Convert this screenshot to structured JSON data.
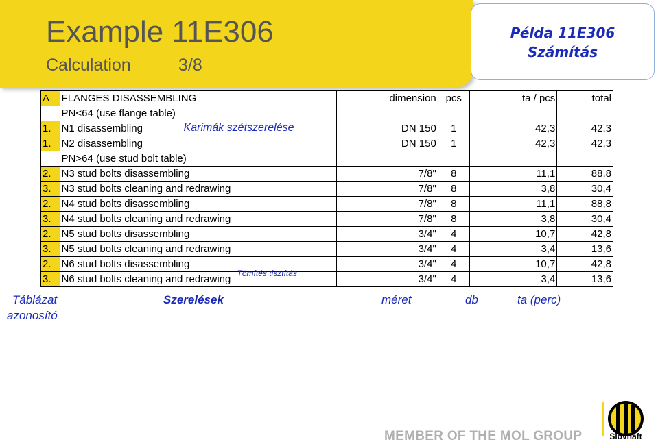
{
  "banner": {
    "title": "Example 11E306",
    "subtitle": "Calculation",
    "page": "3/8"
  },
  "callout": {
    "line1": "Példa  11E306",
    "line2": "Számítás"
  },
  "table": {
    "header": {
      "id": "A",
      "desc": "FLANGES DISASSEMBLING",
      "dim": "dimension",
      "pcs": "pcs",
      "ta": "ta / pcs",
      "total": "total"
    },
    "rows": [
      {
        "id": "",
        "desc": "PN<64 (use flange table)",
        "dim": "",
        "pcs": "",
        "ta": "",
        "total": ""
      },
      {
        "id": "1.",
        "desc": "N1 disassembling",
        "dim": "DN 150",
        "pcs": "1",
        "ta": "42,3",
        "total": "42,3"
      },
      {
        "id": "1.",
        "desc": "N2 disassembling",
        "dim": "DN 150",
        "pcs": "1",
        "ta": "42,3",
        "total": "42,3"
      },
      {
        "id": "",
        "desc": "PN>64 (use stud bolt table)",
        "dim": "",
        "pcs": "",
        "ta": "",
        "total": ""
      },
      {
        "id": "2.",
        "desc": "N3 stud bolts disassembling",
        "dim": "7/8\"",
        "pcs": "8",
        "ta": "11,1",
        "total": "88,8"
      },
      {
        "id": "3.",
        "desc": "N3 stud bolts cleaning and redrawing",
        "dim": "7/8\"",
        "pcs": "8",
        "ta": "3,8",
        "total": "30,4"
      },
      {
        "id": "2.",
        "desc": "N4 stud bolts disassembling",
        "dim": "7/8\"",
        "pcs": "8",
        "ta": "11,1",
        "total": "88,8"
      },
      {
        "id": "3.",
        "desc": "N4 stud bolts cleaning and redrawing",
        "dim": "7/8\"",
        "pcs": "8",
        "ta": "3,8",
        "total": "30,4"
      },
      {
        "id": "2.",
        "desc": "N5 stud bolts disassembling",
        "dim": "3/4\"",
        "pcs": "4",
        "ta": "10,7",
        "total": "42,8"
      },
      {
        "id": "3.",
        "desc": "N5 stud bolts cleaning and redrawing",
        "dim": "3/4\"",
        "pcs": "4",
        "ta": "3,4",
        "total": "13,6"
      },
      {
        "id": "2.",
        "desc": "N6 stud bolts disassembling",
        "dim": "3/4\"",
        "pcs": "4",
        "ta": "10,7",
        "total": "42,8"
      },
      {
        "id": "3.",
        "desc": "N6 stud bolts cleaning and redrawing",
        "dim": "3/4\"",
        "pcs": "4",
        "ta": "3,4",
        "total": "13,6"
      }
    ]
  },
  "annotations": {
    "karimak": "Karimák szétszerelése",
    "tomites": "Tömítés tisztítás"
  },
  "captions": {
    "tablazat": "Táblázat",
    "azonosito": "azonosító",
    "szerelesek": "Szerelések",
    "meret": "méret",
    "db": "db",
    "ta": "ta  (perc)"
  },
  "footer": {
    "member": "MEMBER OF THE MOL GROUP",
    "logo": "Slovnaft"
  },
  "colors": {
    "banner": "#f3d51b",
    "hungarian": "#1a2bb8",
    "footer": "#b0b0b0"
  }
}
